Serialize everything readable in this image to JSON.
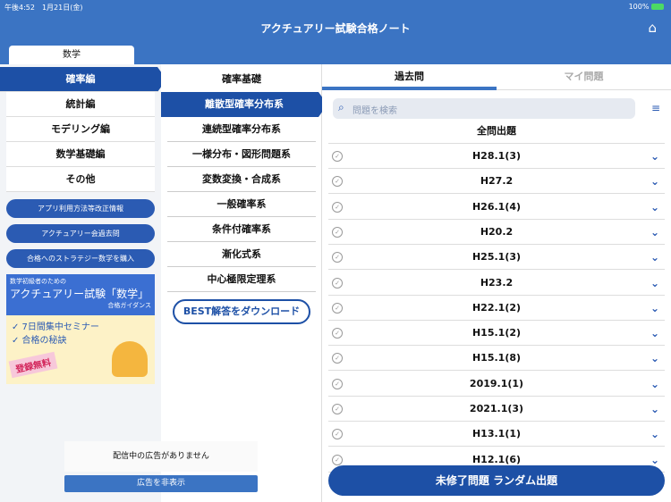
{
  "status": {
    "time": "午後4:52　1月21日(金)",
    "battery": "100%"
  },
  "header": {
    "title": "アクチュアリー試験合格ノート",
    "subject_tab": "数学"
  },
  "left": {
    "items": [
      "確率編",
      "統計編",
      "モデリング編",
      "数学基礎編",
      "その他"
    ],
    "buttons": [
      "アプリ利用方法等改正情報",
      "アクチュアリー会過去問",
      "合格へのストラテジー数学を購入"
    ],
    "ad": {
      "small": "数学初級者のための",
      "big": "アクチュアリー試験「数学」",
      "sub": "合格ガイダンス",
      "points": [
        "✓ 7日間集中セミナー",
        "✓ 合格の秘訣"
      ],
      "badge": "登録無料"
    },
    "no_ads": "配信中の広告がありません",
    "hide_ads": "広告を非表示"
  },
  "middle": {
    "items": [
      "確率基礎",
      "離散型確率分布系",
      "連続型確率分布系",
      "一様分布・図形問題系",
      "変数変換・合成系",
      "一般確率系",
      "条件付確率系",
      "漸化式系",
      "中心極限定理系"
    ],
    "download": "BEST解答をダウンロード"
  },
  "right": {
    "tabs": [
      "過去問",
      "マイ問題"
    ],
    "search_placeholder": "問題を検索",
    "all_label": "全問出題",
    "rows": [
      "H28.1(3)",
      "H27.2",
      "H26.1(4)",
      "H20.2",
      "H25.1(3)",
      "H23.2",
      "H22.1(2)",
      "H15.1(2)",
      "H15.1(8)",
      "2019.1(1)",
      "2021.1(3)",
      "H13.1(1)",
      "H12.1(6)"
    ],
    "random": "未修了問題 ランダム出題"
  }
}
